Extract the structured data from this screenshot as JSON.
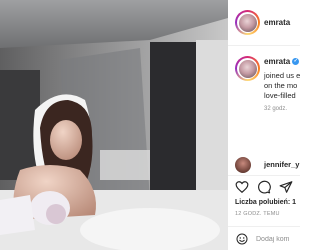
{
  "post": {
    "header": {
      "username": "emrata"
    },
    "caption": {
      "username": "emrata",
      "lines": [
        "joined us e",
        "on the mo",
        "love-filled"
      ],
      "timestamp": "32 godz."
    },
    "comment": {
      "username": "jennifer_y"
    },
    "actions": {
      "like_icon": "heart-icon",
      "comment_icon": "comment-icon",
      "share_icon": "send-icon"
    },
    "likes_label": "Liczba polubień: 1",
    "date": "12 GODZ. TEMU",
    "add_comment": {
      "placeholder": "Dodaj kom",
      "emoji_icon": "emoji-icon"
    }
  },
  "colors": {
    "verified": "#3897f0",
    "muted": "#8e8e8e",
    "text": "#262626",
    "border": "#efefef"
  }
}
